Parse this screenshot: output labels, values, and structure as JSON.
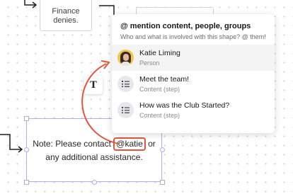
{
  "canvas": {
    "finance_shape_text": "Finance\ndenies.",
    "text_tool_label": "T",
    "note": {
      "prefix": "Note: Please contact",
      "mention": "@katie",
      "suffix_1": " or",
      "line_2": "any additional assistance."
    }
  },
  "mention_panel": {
    "title": "@ mention content, people, groups",
    "subtitle": "Who and what is involved with this shape? @ them!",
    "items": [
      {
        "name": "Katie Liming",
        "type": "Person",
        "icon": "avatar"
      },
      {
        "name": "Meet the team!",
        "type": "Content (step)",
        "icon": "step-list-icon"
      },
      {
        "name": "How was the Club Started?",
        "type": "Content (step)",
        "icon": "step-list-icon"
      }
    ]
  },
  "colors": {
    "annotation_arrow": "#e0563b",
    "selection": "#b9a9f0",
    "connector": "#1f1f23"
  }
}
